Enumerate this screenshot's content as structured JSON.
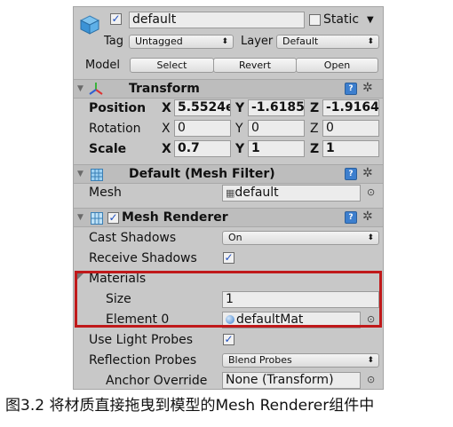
{
  "gameobject": {
    "name": "default",
    "active": true,
    "static_label": "Static",
    "static_checked": false,
    "tag_label": "Tag",
    "tag_value": "Untagged",
    "layer_label": "Layer",
    "layer_value": "Default",
    "model_label": "Model",
    "model_buttons": [
      "Select",
      "Revert",
      "Open"
    ]
  },
  "transform": {
    "title": "Transform",
    "rows": [
      {
        "label": "Position",
        "x": "5.5524e",
        "y": "-1.6185",
        "z": "-1.9164"
      },
      {
        "label": "Rotation",
        "x": "0",
        "y": "0",
        "z": "0"
      },
      {
        "label": "Scale",
        "x": "0.7",
        "y": "1",
        "z": "1"
      }
    ],
    "axis": {
      "x": "X",
      "y": "Y",
      "z": "Z"
    }
  },
  "mesh_filter": {
    "title": "Default (Mesh Filter)",
    "mesh_label": "Mesh",
    "mesh_value": "default"
  },
  "mesh_renderer": {
    "title": "Mesh Renderer",
    "enabled": true,
    "cast_shadows_label": "Cast Shadows",
    "cast_shadows_value": "On",
    "receive_shadows_label": "Receive Shadows",
    "receive_shadows_checked": true,
    "materials_label": "Materials",
    "size_label": "Size",
    "size_value": "1",
    "element0_label": "Element 0",
    "element0_value": "defaultMat",
    "light_probes_label": "Use Light Probes",
    "light_probes_checked": true,
    "reflection_probes_label": "Reflection Probes",
    "reflection_probes_value": "Blend Probes",
    "anchor_override_label": "Anchor Override",
    "anchor_override_value": "None (Transform)"
  },
  "caption": "图3.2 将材质直接拖曳到模型的Mesh Renderer组件中",
  "colors": {
    "highlight": "#c0191a",
    "panel": "#c8c8c8",
    "header": "#bdbdbd",
    "help_icon": "#3d7fce"
  }
}
